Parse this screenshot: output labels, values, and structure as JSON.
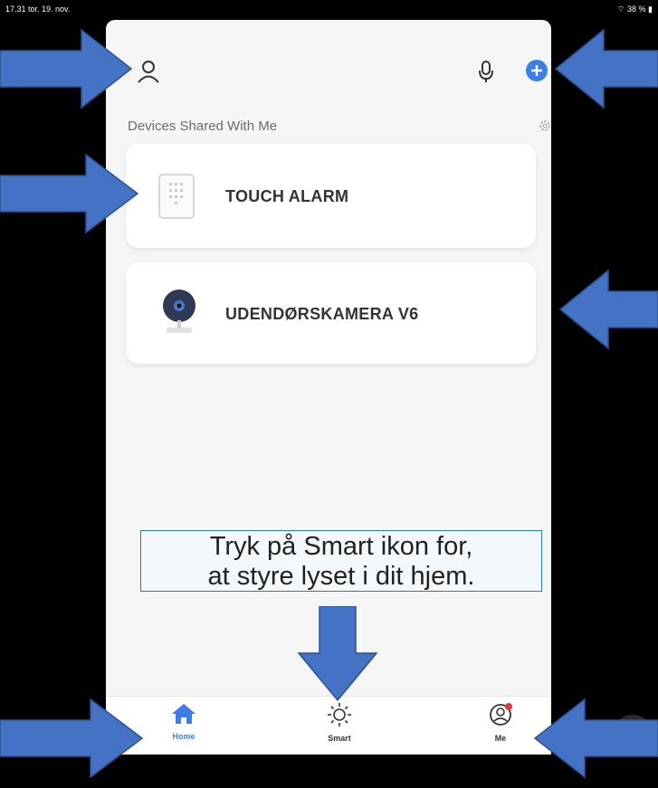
{
  "status_bar": {
    "time_date": "17.31 tor. 19. nov.",
    "battery": "38 %"
  },
  "header": {
    "section_title": "Devices Shared With Me"
  },
  "devices": [
    {
      "name": "TOUCH ALARM",
      "icon": "alarm-keypad-icon"
    },
    {
      "name": "UDENDØRSKAMERA V6",
      "icon": "camera-icon"
    }
  ],
  "tabs": [
    {
      "label": "Home",
      "icon": "home-icon",
      "active": true
    },
    {
      "label": "Smart",
      "icon": "sun-icon",
      "active": false
    },
    {
      "label": "Me",
      "icon": "me-icon",
      "active": false
    }
  ],
  "callout": {
    "line1": "Tryk på Smart ikon for,",
    "line2": "at styre lyset i dit hjem."
  },
  "colors": {
    "accent": "#3d7de8",
    "arrow": "#4472c4",
    "notification": "#e53935"
  }
}
